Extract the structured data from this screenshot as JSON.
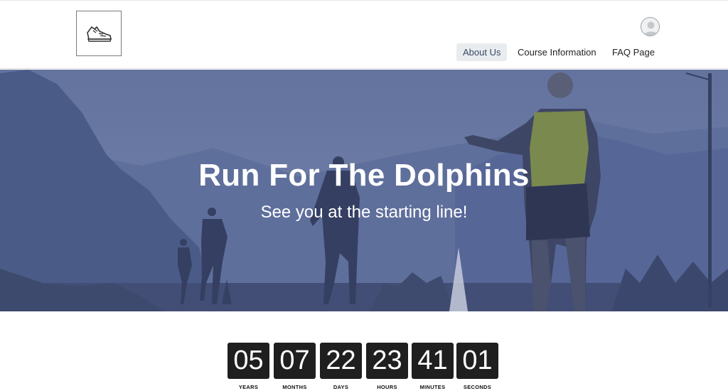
{
  "header": {
    "logo_icon": "running-shoe-icon",
    "avatar_icon": "user-avatar-icon",
    "nav": [
      {
        "label": "About Us",
        "active": true
      },
      {
        "label": "Course Information",
        "active": false
      },
      {
        "label": "FAQ Page",
        "active": false
      }
    ]
  },
  "hero": {
    "title": "Run For The Dolphins",
    "subtitle": "See you at the starting line!",
    "overlay_color": "#4f5f8f"
  },
  "countdown": [
    {
      "value": "05",
      "label": "YEARS"
    },
    {
      "value": "07",
      "label": "MONTHS"
    },
    {
      "value": "22",
      "label": "DAYS"
    },
    {
      "value": "23",
      "label": "HOURS"
    },
    {
      "value": "41",
      "label": "MINUTES"
    },
    {
      "value": "01",
      "label": "SECONDS"
    }
  ]
}
